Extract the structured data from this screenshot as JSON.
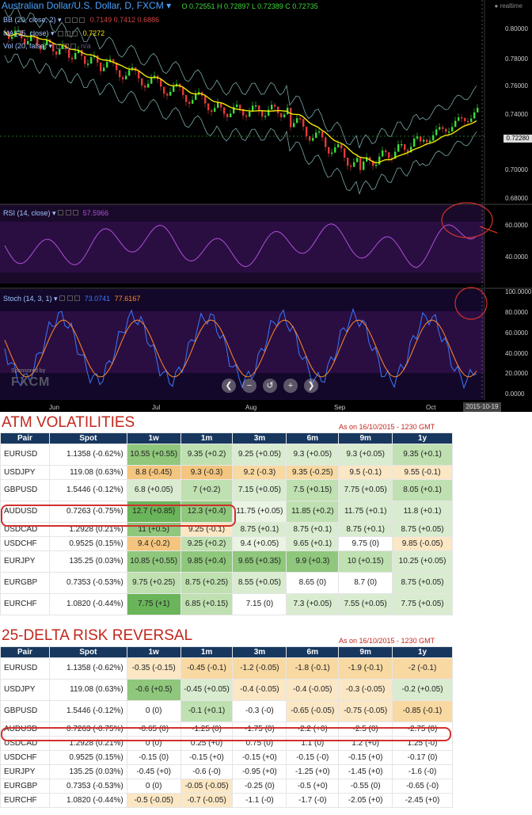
{
  "chart": {
    "title": "Australian Dollar/U.S. Dollar, D, FXCM",
    "ohlc": "O 0.72551  H 0.72897  L 0.72389  C 0.72735",
    "realtime": "realtime",
    "indicators": {
      "bb": {
        "name": "BB (20, close, 2)",
        "values": "0.7149  0.7412  0.6886"
      },
      "ma": {
        "name": "MA (15, close)",
        "values": "0.7272"
      },
      "vol": {
        "name": "Vol (20, false)",
        "values": "n/a"
      }
    },
    "price_axis": [
      "0.80000",
      "0.78000",
      "0.76000",
      "0.74000",
      "0.72280",
      "0.70000",
      "0.68000"
    ],
    "price_tag_current": "0.72280",
    "rsi": {
      "name": "RSI (14, close)",
      "value": "57.5966",
      "axis": [
        "60.0000",
        "40.0000"
      ]
    },
    "stoch": {
      "name": "Stoch (14, 3, 1)",
      "k": "73.0741",
      "d": "77.6167",
      "axis": [
        "100.0000",
        "80.0000",
        "60.0000",
        "40.0000",
        "20.0000",
        "0.0000"
      ]
    },
    "months": [
      "Jun",
      "Jul",
      "Aug",
      "Sep",
      "Oct"
    ],
    "date_tag": "2015-10-19",
    "sponsor": "Sponsored by",
    "sponsor_brand": "FXCM",
    "colors": {
      "up": "#3cdc3c",
      "down": "#e03a3a",
      "ma": "#f2e600",
      "bb": "#7aa7a7",
      "rsi": "#b050d8",
      "stoch_k": "#3a78ff",
      "stoch_d": "#ff8a2a",
      "highlight": "#d0312d"
    }
  },
  "atm": {
    "title": "ATM VOLATILITIES",
    "as_of": "As on 16/10/2015 - 1230 GMT",
    "headers": [
      "Pair",
      "Spot",
      "1w",
      "1m",
      "3m",
      "6m",
      "9m",
      "1y"
    ],
    "rows": [
      {
        "pair": "EURUSD",
        "spot": "1.1358 (-0.62%)",
        "cells": [
          "10.55 (+0.55)",
          "9.35 (+0.2)",
          "9.25 (+0.05)",
          "9.3 (+0.05)",
          "9.3 (+0.05)",
          "9.35 (+0.1)"
        ],
        "shades": [
          "g3",
          "g2",
          "g1",
          "g1",
          "g1",
          "g2"
        ]
      },
      {
        "pair": "USDJPY",
        "spot": "119.08 (0.63%)",
        "cells": [
          "8.8 (-0.45)",
          "9.3 (-0.3)",
          "9.2 (-0.3)",
          "9.35 (-0.25)",
          "9.5 (-0.1)",
          "9.55 (-0.1)"
        ],
        "shades": [
          "o2",
          "o2",
          "o1",
          "o1",
          "o0",
          "o0"
        ]
      },
      {
        "pair": "GBPUSD",
        "spot": "1.5446 (-0.12%)",
        "cells": [
          "6.8 (+0.05)",
          "7 (+0.2)",
          "7.15 (+0.05)",
          "7.5 (+0.15)",
          "7.75 (+0.05)",
          "8.05 (+0.1)"
        ],
        "shades": [
          "g1",
          "g2",
          "g1",
          "g2",
          "g1",
          "g2"
        ]
      },
      {
        "pair": "AUDUSD",
        "spot": "0.7263 (-0.75%)",
        "cells": [
          "12.7 (+0.85)",
          "12.3 (+0.4)",
          "11.75 (+0.05)",
          "11.85 (+0.2)",
          "11.75 (+0.1)",
          "11.8 (+0.1)"
        ],
        "shades": [
          "g4",
          "g3",
          "g0",
          "g2",
          "g1",
          "g1"
        ]
      },
      {
        "pair": "USDCAD",
        "spot": "1.2928 (0.21%)",
        "cells": [
          "11 (+0.5)",
          "9.25 (-0.1)",
          "8.75 (+0.1)",
          "8.75 (+0.1)",
          "8.75 (+0.1)",
          "8.75 (+0.05)"
        ],
        "shades": [
          "g3",
          "o0",
          "g1",
          "g1",
          "g1",
          "g1"
        ]
      },
      {
        "pair": "USDCHF",
        "spot": "0.9525 (0.15%)",
        "cells": [
          "9.4 (-0.2)",
          "9.25 (+0.2)",
          "9.4 (+0.05)",
          "9.65 (+0.1)",
          "9.75 (0)",
          "9.85 (-0.05)"
        ],
        "shades": [
          "o2",
          "g2",
          "g0",
          "g1",
          "w",
          "o0"
        ]
      },
      {
        "pair": "EURJPY",
        "spot": "135.25 (0.03%)",
        "cells": [
          "10.85 (+0.55)",
          "9.85 (+0.4)",
          "9.65 (+0.35)",
          "9.9 (+0.3)",
          "10 (+0.15)",
          "10.25 (+0.05)"
        ],
        "shades": [
          "g3",
          "g3",
          "g3",
          "g3",
          "g2",
          "g1"
        ]
      },
      {
        "pair": "EURGBP",
        "spot": "0.7353 (-0.53%)",
        "cells": [
          "9.75 (+0.25)",
          "8.75 (+0.25)",
          "8.55 (+0.05)",
          "8.65 (0)",
          "8.7 (0)",
          "8.75 (+0.05)"
        ],
        "shades": [
          "g2",
          "g2",
          "g1",
          "w",
          "w",
          "g1"
        ]
      },
      {
        "pair": "EURCHF",
        "spot": "1.0820 (-0.44%)",
        "cells": [
          "7.75 (+1)",
          "6.85 (+0.15)",
          "7.15 (0)",
          "7.3 (+0.05)",
          "7.55 (+0.05)",
          "7.75 (+0.05)"
        ],
        "shades": [
          "g4",
          "g2",
          "w",
          "g1",
          "g1",
          "g1"
        ]
      }
    ]
  },
  "rr": {
    "title": "25-DELTA RISK REVERSAL",
    "as_of": "As on 16/10/2015 - 1230 GMT",
    "headers": [
      "Pair",
      "Spot",
      "1w",
      "1m",
      "3m",
      "6m",
      "9m",
      "1y"
    ],
    "rows": [
      {
        "pair": "EURUSD",
        "spot": "1.1358 (-0.62%)",
        "cells": [
          "-0.35 (-0.15)",
          "-0.45 (-0.1)",
          "-1.2 (-0.05)",
          "-1.8 (-0.1)",
          "-1.9 (-0.1)",
          "-2 (-0.1)"
        ],
        "shades": [
          "o0",
          "o1",
          "o1",
          "o1",
          "o1",
          "o1"
        ]
      },
      {
        "pair": "USDJPY",
        "spot": "119.08 (0.63%)",
        "cells": [
          "-0.6 (+0.5)",
          "-0.45 (+0.05)",
          "-0.4 (-0.05)",
          "-0.4 (-0.05)",
          "-0.3 (-0.05)",
          "-0.2 (+0.05)"
        ],
        "shades": [
          "g3",
          "g1",
          "o0",
          "o0",
          "o0",
          "g1"
        ]
      },
      {
        "pair": "GBPUSD",
        "spot": "1.5446 (-0.12%)",
        "cells": [
          "0 (0)",
          "-0.1 (+0.1)",
          "-0.3 (-0)",
          "-0.65 (-0.05)",
          "-0.75 (-0.05)",
          "-0.85 (-0.1)"
        ],
        "shades": [
          "w",
          "g2",
          "w",
          "o0",
          "o0",
          "o1"
        ]
      },
      {
        "pair": "AUDUSD",
        "spot": "0.7263 (-0.75%)",
        "cells": [
          "-0.65 (0)",
          "-1.25 (0)",
          "-1.75 (0)",
          "-2.2 (+0)",
          "-2.5 (0)",
          "-2.75 (0)"
        ],
        "shades": [
          "w",
          "w",
          "w",
          "w",
          "w",
          "w"
        ]
      },
      {
        "pair": "USDCAD",
        "spot": "1.2928 (0.21%)",
        "cells": [
          "0 (0)",
          "0.25 (+0)",
          "0.75 (0)",
          "1.1 (0)",
          "1.2 (+0)",
          "1.25 (-0)"
        ],
        "shades": [
          "w",
          "w",
          "w",
          "w",
          "w",
          "w"
        ]
      },
      {
        "pair": "USDCHF",
        "spot": "0.9525 (0.15%)",
        "cells": [
          "-0.15 (0)",
          "-0.15 (+0)",
          "-0.15 (+0)",
          "-0.15 (-0)",
          "-0.15 (+0)",
          "-0.17 (0)"
        ],
        "shades": [
          "w",
          "w",
          "w",
          "w",
          "w",
          "w"
        ]
      },
      {
        "pair": "EURJPY",
        "spot": "135.25 (0.03%)",
        "cells": [
          "-0.45 (+0)",
          "-0.6 (-0)",
          "-0.95 (+0)",
          "-1.25 (+0)",
          "-1.45 (+0)",
          "-1.6 (-0)"
        ],
        "shades": [
          "w",
          "w",
          "w",
          "w",
          "w",
          "w"
        ]
      },
      {
        "pair": "EURGBP",
        "spot": "0.7353 (-0.53%)",
        "cells": [
          "0 (0)",
          "-0.05 (-0.05)",
          "-0.25 (0)",
          "-0.5 (+0)",
          "-0.55 (0)",
          "-0.65 (-0)"
        ],
        "shades": [
          "w",
          "o0",
          "w",
          "w",
          "w",
          "w"
        ]
      },
      {
        "pair": "EURCHF",
        "spot": "1.0820 (-0.44%)",
        "cells": [
          "-0.5 (-0.05)",
          "-0.7 (-0.05)",
          "-1.1 (-0)",
          "-1.7 (-0)",
          "-2.05 (+0)",
          "-2.45 (+0)"
        ],
        "shades": [
          "o0",
          "o0",
          "w",
          "w",
          "w",
          "w"
        ]
      }
    ]
  }
}
